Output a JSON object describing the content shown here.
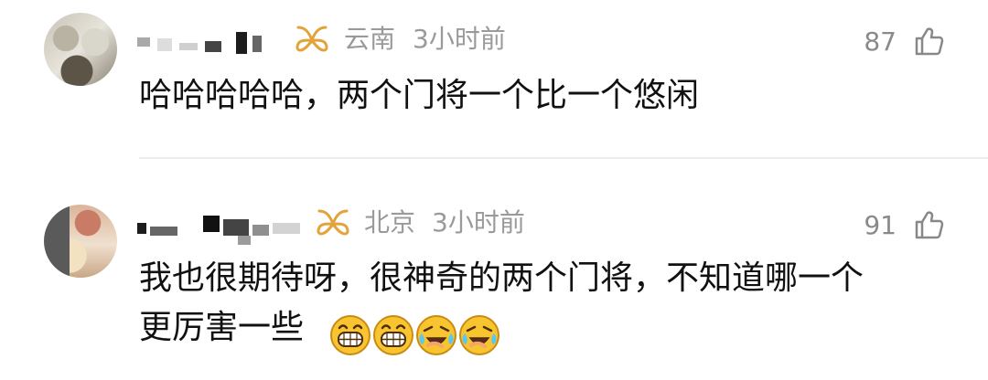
{
  "comments": [
    {
      "location": "云南",
      "time": "3小时前",
      "likes": "87",
      "text": "哈哈哈哈哈，两个门将一个比一个悠闲"
    },
    {
      "location": "北京",
      "time": "3小时前",
      "likes": "91",
      "text_line1": "我也很期待呀，很神奇的两个门将，不知道哪一个",
      "text_line2": "更厉害一些"
    }
  ],
  "icons": {
    "vip": "vip-badge-icon",
    "like": "thumbs-up-icon",
    "emoji_grin": "grinning-emoji-icon",
    "emoji_laugh_cry": "rolling-laughing-emoji-icon"
  },
  "colors": {
    "meta_text": "#9a9a9a",
    "like_text": "#8a8a8a",
    "vip_gold": "#e3a33b"
  }
}
